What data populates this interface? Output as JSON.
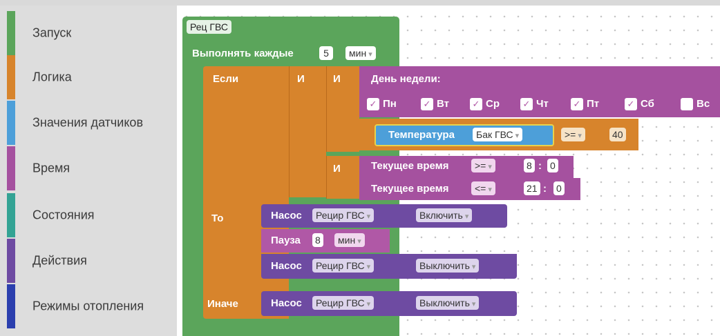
{
  "sidebar": {
    "items": [
      {
        "label": "Запуск",
        "color": "#5ba55b"
      },
      {
        "label": "Логика",
        "color": "#d7842c"
      },
      {
        "label": "Значения датчиков",
        "color": "#4d9fd9"
      },
      {
        "label": "Время",
        "color": "#a5519f"
      },
      {
        "label": "Состояния",
        "color": "#33a394"
      },
      {
        "label": "Действия",
        "color": "#6e4ba2"
      },
      {
        "label": "Режимы отопления",
        "color": "#2b3fae"
      }
    ]
  },
  "workspace": {
    "routine": {
      "name": "Рец ГВС",
      "repeat_label": "Выполнять каждые",
      "repeat_value": "5",
      "repeat_unit": "мин"
    },
    "if_block": {
      "if_label": "Если",
      "and1": "И",
      "and2": "И",
      "and3": "И",
      "then_label": "То",
      "else_label": "Иначе"
    },
    "weekday": {
      "label": "День недели:",
      "days": [
        {
          "name": "Пн",
          "checked": "✓"
        },
        {
          "name": "Вт",
          "checked": "✓"
        },
        {
          "name": "Ср",
          "checked": "✓"
        },
        {
          "name": "Чт",
          "checked": "✓"
        },
        {
          "name": "Пт",
          "checked": "✓"
        },
        {
          "name": "Сб",
          "checked": "✓"
        },
        {
          "name": "Вс",
          "checked": ""
        }
      ]
    },
    "temperature": {
      "label": "Температура",
      "sensor": "Бак ГВС",
      "operator": ">=",
      "value": "40"
    },
    "time1": {
      "label": "Текущее время",
      "operator": ">=",
      "hour": "8",
      "sep": ":",
      "minute": "0"
    },
    "time2": {
      "label": "Текущее время",
      "operator": "<=",
      "hour": "21",
      "sep": ":",
      "minute": "0"
    },
    "then_actions": {
      "pump1": {
        "label": "Насос",
        "device": "Рецир ГВС",
        "action": "Включить"
      },
      "pause": {
        "label": "Пауза",
        "value": "8",
        "unit": "мин"
      },
      "pump2": {
        "label": "Насос",
        "device": "Рецир ГВС",
        "action": "Выключить"
      }
    },
    "else_actions": {
      "pump": {
        "label": "Насос",
        "device": "Рецир ГВС",
        "action": "Выключить"
      }
    }
  }
}
